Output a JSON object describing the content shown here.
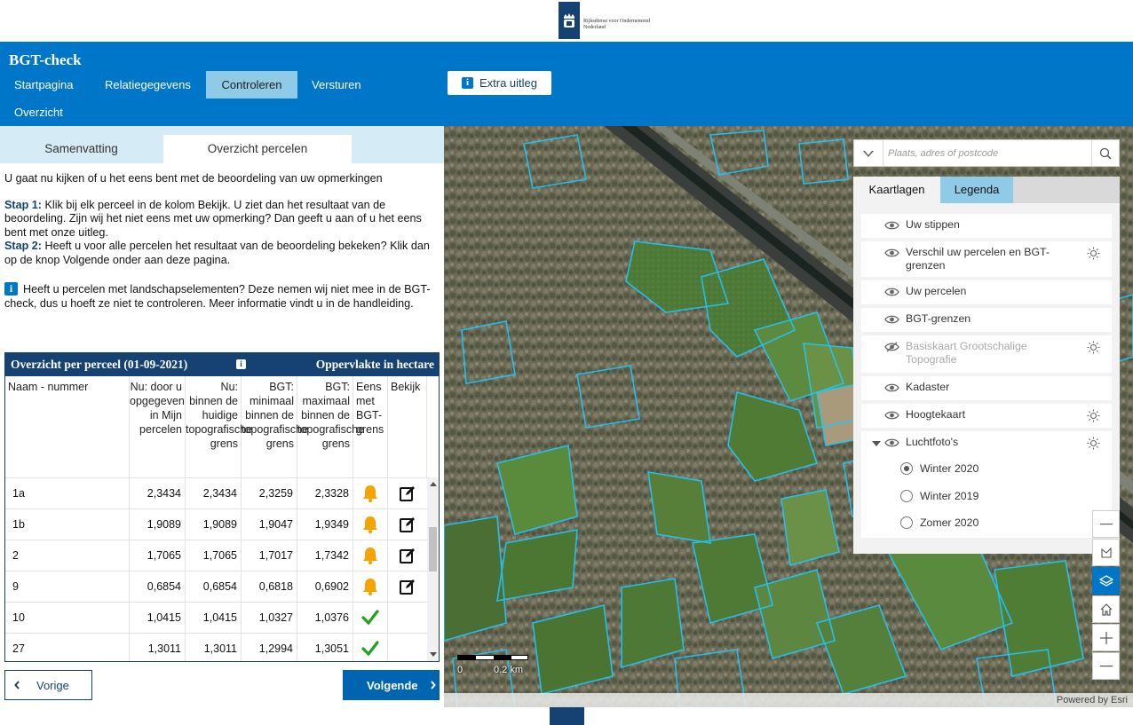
{
  "logo": {
    "org_line1": "Rijksdienst voor Ondernemend",
    "org_line2": "Nederland"
  },
  "header": {
    "title": "BGT-check",
    "nav": [
      "Startpagina",
      "Relatiegegevens",
      "Controleren",
      "Versturen",
      "Overzicht"
    ],
    "active_nav": "Controleren",
    "extra_button": "Extra uitleg"
  },
  "tabs": {
    "summary": "Samenvatting",
    "overview": "Overzicht percelen",
    "active": "Overzicht percelen"
  },
  "intro": {
    "line": "U gaat nu kijken of u het eens bent met de beoordeling van uw opmerkingen",
    "step1_label": "Stap 1:",
    "step1_text": " Klik bij elk perceel in de kolom Bekijk. U ziet dan het resultaat van de beoordeling. Zijn wij het niet eens met uw opmerking? Dan geeft u aan of u het eens bent met onze uitleg.",
    "step2_label": "Stap 2:",
    "step2_text": " Heeft u voor alle percelen het resultaat van de beoordeling bekeken? Klik dan op de knop Volgende onder aan deze pagina.",
    "note": "Heeft u percelen met landschapselementen? Deze nemen wij niet mee in de BGT-check, dus u hoeft ze niet te controleren. Meer informatie vindt u in de handleiding."
  },
  "table": {
    "title": "Overzicht per perceel (01-09-2021)",
    "right_title": "Oppervlakte in hectare",
    "columns": [
      "Naam - nummer",
      "Nu: door u opgegeven in Mijn percelen",
      "Nu: binnen de huidige topografische grens",
      "BGT: minimaal binnen de topografische grens",
      "BGT: maximaal binnen de topografische grens",
      "Eens met BGT-grens",
      "Bekijk"
    ],
    "rows": [
      {
        "name": "1a",
        "opgegeven": "2,3434",
        "huidig": "2,3434",
        "min": "2,3259",
        "max": "2,3328",
        "status": "bell",
        "bekijk": true
      },
      {
        "name": "1b",
        "opgegeven": "1,9089",
        "huidig": "1,9089",
        "min": "1,9047",
        "max": "1,9349",
        "status": "bell",
        "bekijk": true
      },
      {
        "name": "2",
        "opgegeven": "1,7065",
        "huidig": "1,7065",
        "min": "1,7017",
        "max": "1,7342",
        "status": "bell",
        "bekijk": true
      },
      {
        "name": "9",
        "opgegeven": "0,6854",
        "huidig": "0,6854",
        "min": "0,6818",
        "max": "0,6902",
        "status": "bell",
        "bekijk": true
      },
      {
        "name": "10",
        "opgegeven": "1,0415",
        "huidig": "1,0415",
        "min": "1,0327",
        "max": "1,0376",
        "status": "check",
        "bekijk": false
      },
      {
        "name": "27",
        "opgegeven": "1,3011",
        "huidig": "1,3011",
        "min": "1,2994",
        "max": "1,3051",
        "status": "check",
        "bekijk": false
      }
    ]
  },
  "buttons": {
    "prev": "Vorige",
    "next": "Volgende"
  },
  "map": {
    "search_placeholder": "Plaats, adres of postcode",
    "panel_tabs": [
      "Kaartlagen",
      "Legenda"
    ],
    "active_panel_tab": "Kaartlagen",
    "layers": [
      {
        "label": "Uw stippen",
        "visible": true,
        "settings": false
      },
      {
        "label": "Verschil uw percelen en BGT-grenzen",
        "visible": true,
        "settings": true
      },
      {
        "label": "Uw percelen",
        "visible": true,
        "settings": false
      },
      {
        "label": "BGT-grenzen",
        "visible": true,
        "settings": false
      },
      {
        "label": "Basiskaart Grootschalige Topografie",
        "visible": false,
        "settings": true
      },
      {
        "label": "Kadaster",
        "visible": true,
        "settings": false
      },
      {
        "label": "Hoogtekaart",
        "visible": true,
        "settings": true
      },
      {
        "label": "Luchtfoto's",
        "visible": true,
        "settings": true,
        "expanded": true
      }
    ],
    "basemap_options": [
      "Winter 2020",
      "Winter 2019",
      "Zomer 2020"
    ],
    "selected_basemap": "Winter 2020",
    "scale_start": "0",
    "scale_label": "0.2 km",
    "attribution": "Powered by Esri",
    "accent_color": "#0076c8",
    "parcel_color": "#1ec8ff"
  }
}
